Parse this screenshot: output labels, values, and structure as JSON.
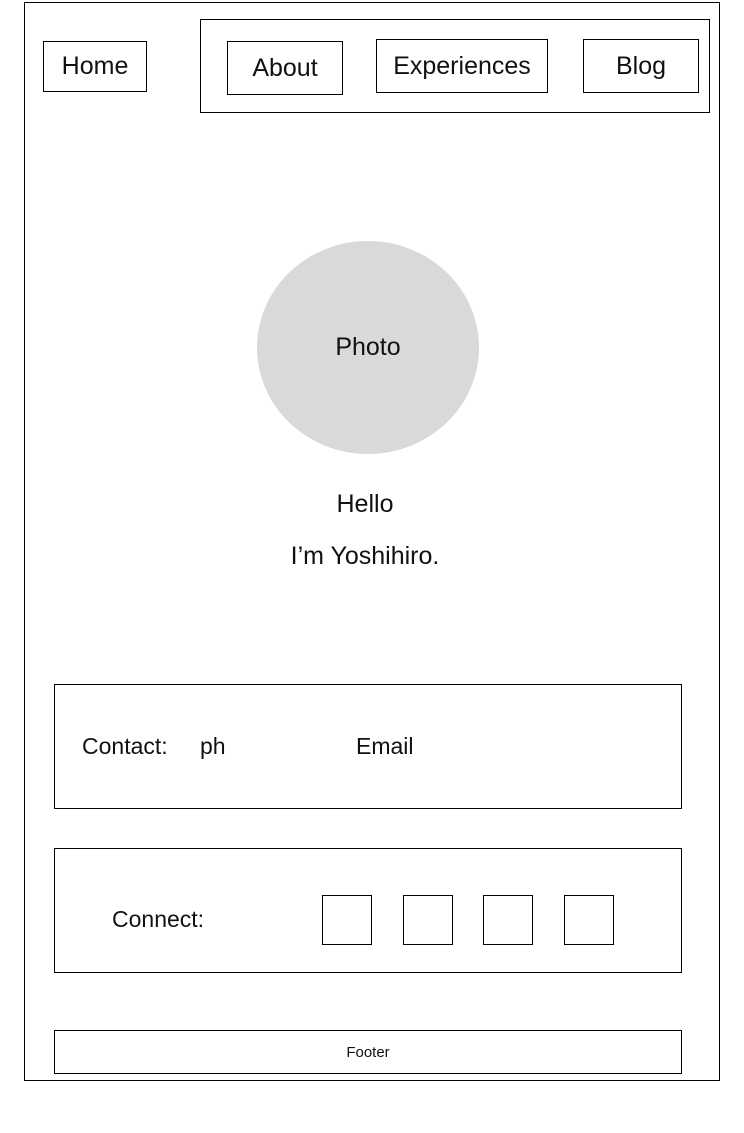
{
  "nav": {
    "home_label": "Home",
    "about_label": "About",
    "experiences_label": "Experiences",
    "blog_label": "Blog"
  },
  "hero": {
    "photo_label": "Photo",
    "greeting": "Hello",
    "intro": "I’m Yoshihiro."
  },
  "contact": {
    "label": "Contact:",
    "phone": "ph",
    "email": "Email"
  },
  "connect": {
    "label": "Connect:",
    "icons": [
      "social-link-1",
      "social-link-2",
      "social-link-3",
      "social-link-4"
    ]
  },
  "footer": {
    "text": "Footer"
  }
}
